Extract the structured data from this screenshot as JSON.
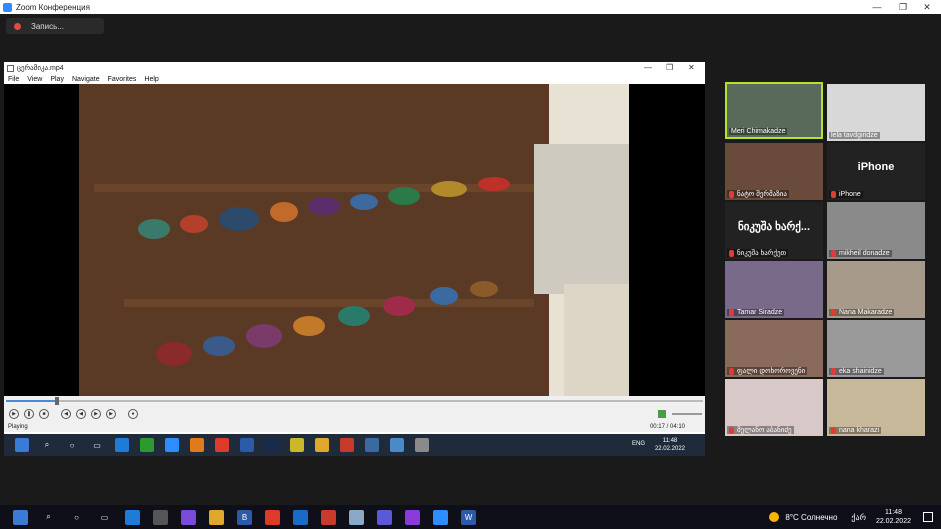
{
  "zoom_window": {
    "title": "Zoom Конференция",
    "recording_label": "Запись...",
    "controls": {
      "minimize": "—",
      "maximize": "❐",
      "close": "✕"
    }
  },
  "player": {
    "file_name": "ცერამიკა.mp4",
    "menu": [
      "File",
      "View",
      "Play",
      "Navigate",
      "Favorites",
      "Help"
    ],
    "time": "00:17 / 04:10",
    "progress": 0.07,
    "status": "Playing",
    "window_controls": {
      "minimize": "—",
      "maximize": "❐",
      "close": "✕"
    }
  },
  "inner_taskbar": {
    "lang": "ENG",
    "time": "11:48",
    "date": "22.02.2022"
  },
  "participants": [
    {
      "name": "Meri Chimakadze",
      "active": true,
      "muted": false
    },
    {
      "name": "lela tavdgiridze",
      "muted": false
    },
    {
      "name": "ნატო შერმაზია",
      "muted": true
    },
    {
      "name": "iPhone",
      "label": "iPhone",
      "muted": true
    },
    {
      "name": "ნიკუშა ხარქეთ",
      "label": "ნიკუშა ხარქ...",
      "muted": true
    },
    {
      "name": "mikheil donadze",
      "muted": true
    },
    {
      "name": "Tamar Siradze",
      "muted": true
    },
    {
      "name": "Nana Makaradze",
      "muted": true
    },
    {
      "name": "ფალი დოხოროვენი",
      "muted": true
    },
    {
      "name": "eka shainidze",
      "muted": true
    },
    {
      "name": "მელანო აბანიძე",
      "muted": true
    },
    {
      "name": "nana kharazi",
      "muted": true
    }
  ],
  "taskbar": {
    "weather": "8°C Солнечно",
    "lang": "ქარ",
    "time": "11:48",
    "date": "22.02.2022"
  }
}
